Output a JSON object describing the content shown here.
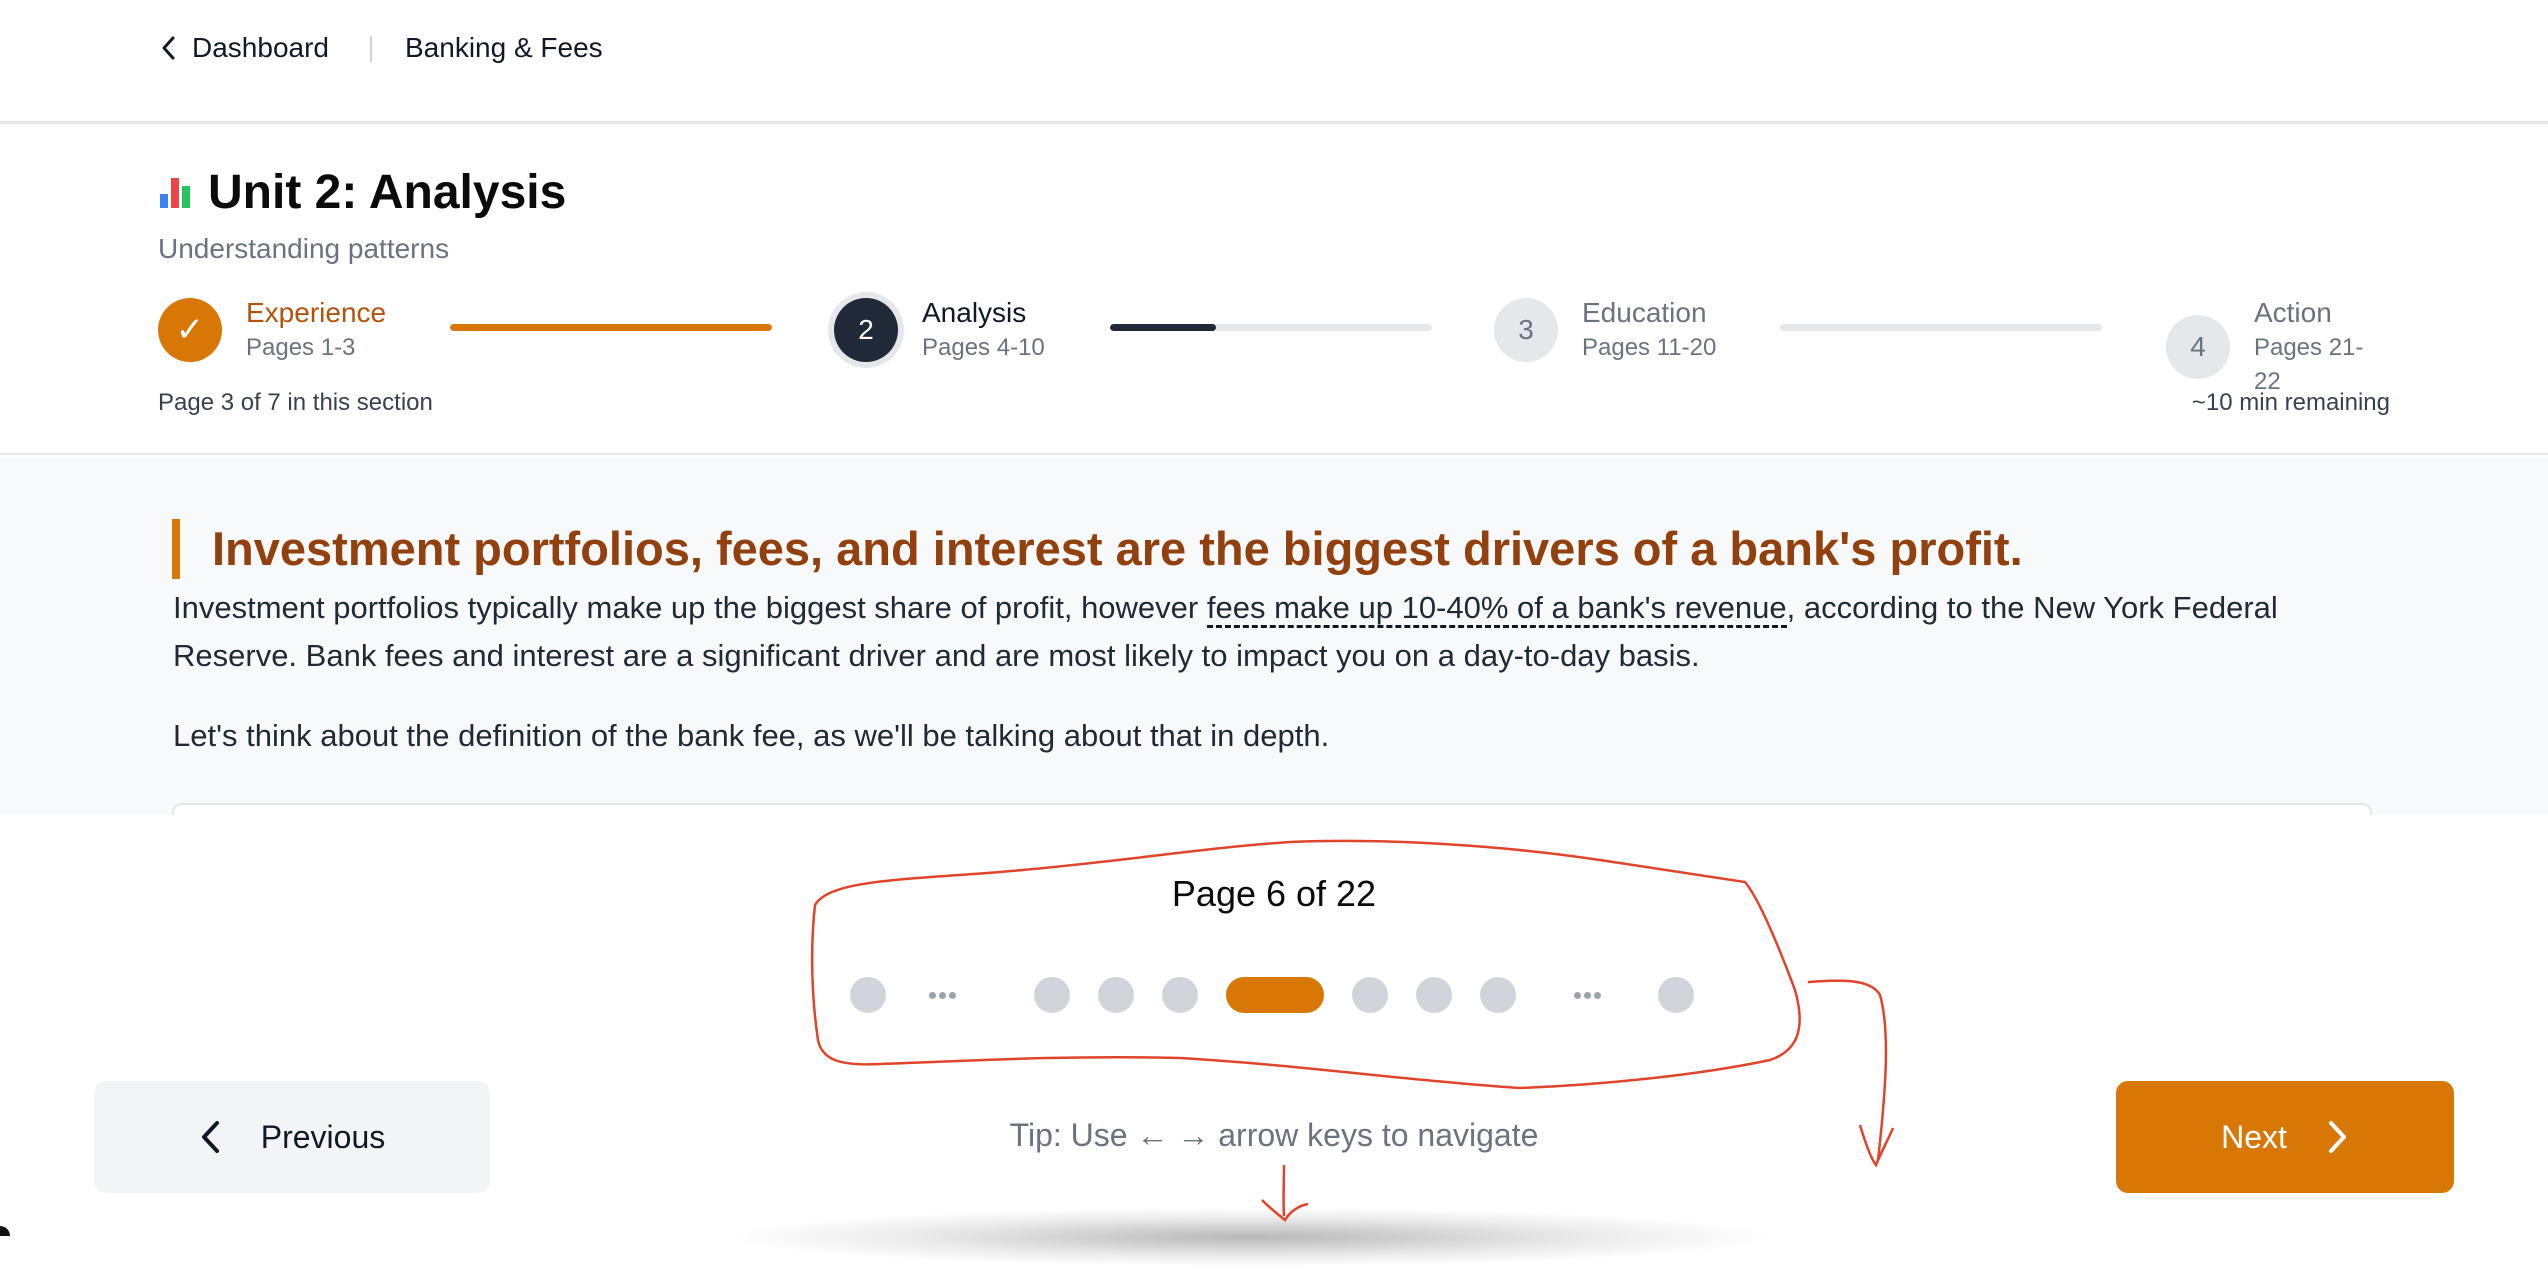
{
  "nav": {
    "back_label": "Dashboard",
    "current_label": "Banking & Fees"
  },
  "unit": {
    "title": "Unit 2: Analysis",
    "subtitle": "Understanding patterns",
    "icon": "bar-chart-emoji"
  },
  "stepper": {
    "steps": [
      {
        "name": "Experience",
        "pages": "Pages 1-3",
        "state": "done",
        "marker": "✓"
      },
      {
        "name": "Analysis",
        "pages": "Pages 4-10",
        "state": "current",
        "marker": "2"
      },
      {
        "name": "Education",
        "pages": "Pages 11-20",
        "state": "future",
        "marker": "3"
      },
      {
        "name": "Action",
        "pages": "Pages 21-22",
        "state": "future",
        "marker": "4"
      }
    ],
    "track_progress": [
      1.0,
      0.33,
      0.0
    ],
    "section_progress": "Page 3 of 7 in this section",
    "time_remaining": "~10 min remaining"
  },
  "content": {
    "heading": "Investment portfolios, fees, and interest are the biggest drivers of a bank's profit.",
    "para1_before": "Investment portfolios typically make up the biggest share of profit, however ",
    "para1_term": "fees make up 10-40% of a bank's revenue",
    "para1_after": ", according to the New York Federal Reserve. Bank fees and interest are a significant driver and are most likely to impact you on a day-to-day basis.",
    "para2": "Let's think about the definition of the bank fee, as we'll be talking about that in depth."
  },
  "pager": {
    "label": "Page 6 of 22",
    "current_page": 6,
    "total_pages": 22,
    "tip": "Tip: Use ← → arrow keys to navigate",
    "prev_label": "Previous",
    "next_label": "Next"
  },
  "colors": {
    "accent": "#d97706",
    "accent_dark": "#92400e",
    "current_step": "#1f2937",
    "annotation": "#e0442a"
  }
}
